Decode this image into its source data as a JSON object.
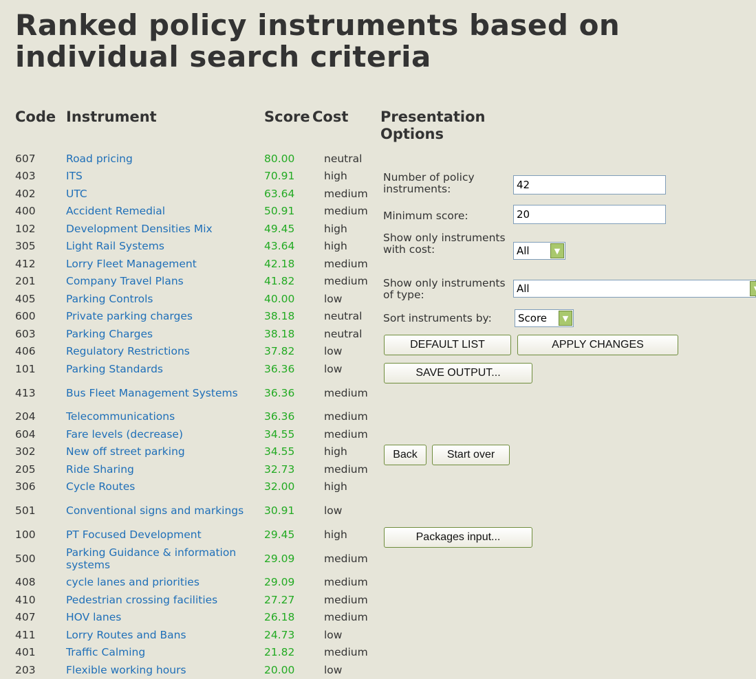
{
  "title": "Ranked policy instruments based on individual search criteria",
  "headers": {
    "code": "Code",
    "instrument": "Instrument",
    "score": "Score",
    "cost": "Cost"
  },
  "options": {
    "title": "Presentation Options",
    "num_label": "Number of policy instruments:",
    "num_value": "42",
    "min_label": "Minimum score:",
    "min_value": "20",
    "cost_label": "Show only instruments with cost:",
    "cost_value": "All",
    "type_label": "Show only instruments of type:",
    "type_value": "All",
    "sort_label": "Sort instruments by:",
    "sort_value": "Score"
  },
  "buttons": {
    "default_list": "DEFAULT LIST",
    "apply": "APPLY CHANGES",
    "save": "SAVE OUTPUT...",
    "back": "Back",
    "start_over": "Start over",
    "packages": "Packages input..."
  },
  "rows": [
    {
      "code": "607",
      "name": "Road pricing",
      "score": "80.00",
      "cost": "neutral"
    },
    {
      "code": "403",
      "name": "ITS",
      "score": "70.91",
      "cost": "high"
    },
    {
      "code": "402",
      "name": "UTC",
      "score": "63.64",
      "cost": "medium"
    },
    {
      "code": "400",
      "name": "Accident Remedial",
      "score": "50.91",
      "cost": "medium"
    },
    {
      "code": "102",
      "name": "Development Densities Mix",
      "score": "49.45",
      "cost": "high"
    },
    {
      "code": "305",
      "name": "Light Rail Systems",
      "score": "43.64",
      "cost": "high"
    },
    {
      "code": "412",
      "name": "Lorry Fleet Management",
      "score": "42.18",
      "cost": "medium"
    },
    {
      "code": "201",
      "name": "Company Travel Plans",
      "score": "41.82",
      "cost": "medium"
    },
    {
      "code": "405",
      "name": "Parking Controls",
      "score": "40.00",
      "cost": "low"
    },
    {
      "code": "600",
      "name": "Private parking charges",
      "score": "38.18",
      "cost": "neutral"
    },
    {
      "code": "603",
      "name": "Parking Charges",
      "score": "38.18",
      "cost": "neutral"
    },
    {
      "code": "406",
      "name": "Regulatory Restrictions",
      "score": "37.82",
      "cost": "low"
    },
    {
      "code": "101",
      "name": "Parking Standards",
      "score": "36.36",
      "cost": "low"
    },
    {
      "code": "413",
      "name": "Bus Fleet Management Systems",
      "score": "36.36",
      "cost": "medium"
    },
    {
      "code": "204",
      "name": "Telecommunications",
      "score": "36.36",
      "cost": "medium"
    },
    {
      "code": "604",
      "name": "Fare levels (decrease)",
      "score": "34.55",
      "cost": "medium"
    },
    {
      "code": "302",
      "name": "New off street parking",
      "score": "34.55",
      "cost": "high"
    },
    {
      "code": "205",
      "name": "Ride Sharing",
      "score": "32.73",
      "cost": "medium"
    },
    {
      "code": "306",
      "name": "Cycle Routes",
      "score": "32.00",
      "cost": "high"
    },
    {
      "code": "501",
      "name": "Conventional signs and markings",
      "score": "30.91",
      "cost": "low"
    },
    {
      "code": "100",
      "name": "PT Focused Development",
      "score": "29.45",
      "cost": "high"
    },
    {
      "code": "500",
      "name": "Parking Guidance & information systems",
      "score": "29.09",
      "cost": "medium"
    },
    {
      "code": "408",
      "name": "cycle lanes and priorities",
      "score": "29.09",
      "cost": "medium"
    },
    {
      "code": "410",
      "name": "Pedestrian crossing facilities",
      "score": "27.27",
      "cost": "medium"
    },
    {
      "code": "407",
      "name": "HOV lanes",
      "score": "26.18",
      "cost": "medium"
    },
    {
      "code": "411",
      "name": "Lorry Routes and Bans",
      "score": "24.73",
      "cost": "low"
    },
    {
      "code": "401",
      "name": "Traffic Calming",
      "score": "21.82",
      "cost": "medium"
    },
    {
      "code": "203",
      "name": "Flexible working hours",
      "score": "20.00",
      "cost": "low"
    }
  ]
}
